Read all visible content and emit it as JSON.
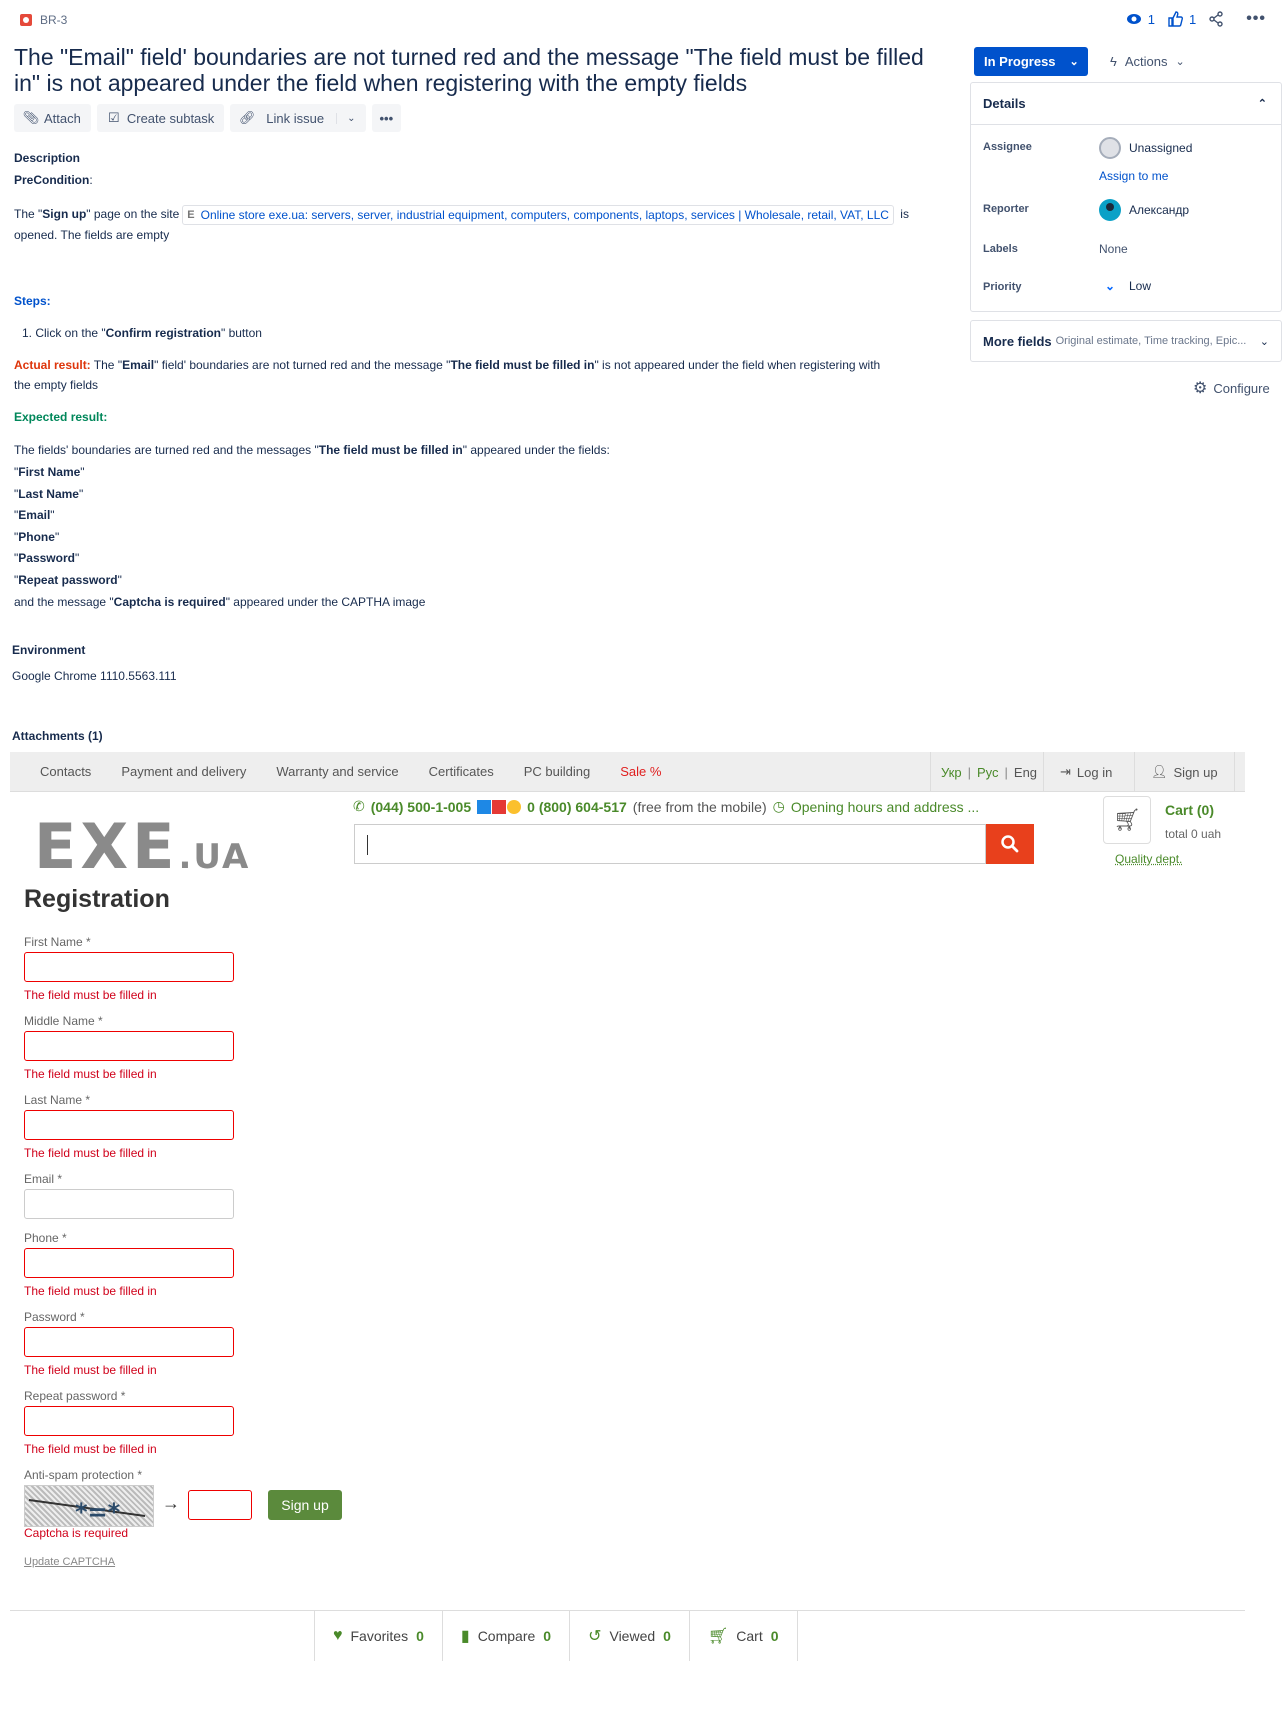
{
  "issue": {
    "key": "BR-3",
    "title": "The \"Email\" field' boundaries are not turned red and the message \"The field must be filled in\" is not appeared under the field when registering with the empty fields",
    "watchers": "1",
    "likes": "1"
  },
  "toolbar": {
    "attach": "Attach",
    "create_subtask": "Create subtask",
    "link_issue": "Link issue"
  },
  "description": {
    "heading": "Description",
    "precondition_label": "PreCondition",
    "precondition_colon": ":",
    "pre_text_1": "The \"",
    "pre_bold": "Sign up",
    "pre_text_2": "\" page on the site",
    "link_text": "Online store exe.ua: servers, server, industrial equipment, computers, components, laptops, services | Wholesale, retail, VAT, LLC",
    "pre_text_3": " is",
    "pre_text_4": "opened. The fields are empty",
    "steps_label": "Steps:",
    "step_1_a": "1. Click on the \"",
    "step_1_bold": "Confirm registration",
    "step_1_b": "\" button",
    "actual_label": "Actual result:",
    "actual_a": " The \"",
    "actual_bold1": "Email",
    "actual_b": "\" field' boundaries are not turned red and the message \"",
    "actual_bold2": "The field must be filled in",
    "actual_c": "\" is not appeared under the field when registering with",
    "actual_d": "the empty fields",
    "expected_label": "Expected result:",
    "expected_a": "The fields' boundaries are turned red and the messages \"",
    "expected_bold": "The field must be filled in",
    "expected_b": "\" appeared under the fields:",
    "fields": [
      "First Name",
      "Last Name",
      "Email",
      "Phone",
      "Password",
      "Repeat password"
    ],
    "captcha_a": "and the message \"",
    "captcha_bold": "Captcha is required",
    "captcha_b": "\" appeared under the CAPTHA image"
  },
  "environment": {
    "heading": "Environment",
    "value": "Google Chrome 1110.5563.111"
  },
  "attachments": {
    "heading": "Attachments (1)"
  },
  "sidebar": {
    "status": "In Progress",
    "actions": "Actions",
    "details_heading": "Details",
    "assignee_label": "Assignee",
    "assignee_value": "Unassigned",
    "assign_to_me": "Assign to me",
    "reporter_label": "Reporter",
    "reporter_value": "Александр",
    "labels_label": "Labels",
    "labels_value": "None",
    "priority_label": "Priority",
    "priority_value": "Low",
    "more_fields": "More fields",
    "more_fields_sub": "Original estimate, Time tracking, Epic...",
    "configure": "Configure"
  },
  "site": {
    "nav": [
      "Contacts",
      "Payment and delivery",
      "Warranty and service",
      "Certificates",
      "PC building"
    ],
    "sale": "Sale %",
    "lang_ukr": "Укр",
    "lang_rus": "Рус",
    "lang_eng": "Eng",
    "sep": "|",
    "login": "Log in",
    "signup": "Sign up",
    "logo_main": "EXE",
    "logo_small": ".UA",
    "phone1": "(044) 500-1-005",
    "phone2": "0 (800) 604-517",
    "phone2_note": "(free from the mobile)",
    "hours": "Opening hours and address ...",
    "cart_title": "Cart (0)",
    "cart_total": "total 0 uah",
    "quality": "Quality dept.",
    "reg_title": "Registration",
    "fields": [
      {
        "label": "First Name *",
        "error": "The field must be filled in"
      },
      {
        "label": "Middle Name *",
        "error": "The field must be filled in"
      },
      {
        "label": "Last Name *",
        "error": "The field must be filled in"
      },
      {
        "label": "Email *",
        "error": ""
      },
      {
        "label": "Phone *",
        "error": "The field must be filled in"
      },
      {
        "label": "Password *",
        "error": "The field must be filled in"
      },
      {
        "label": "Repeat password *",
        "error": "The field must be filled in"
      }
    ],
    "antispam_label": "Anti-spam protection *",
    "captcha_error": "Captcha is required",
    "signup_button": "Sign up",
    "update_captcha": "Update CAPTCHA",
    "bottom": {
      "favorites": "Favorites",
      "favorites_n": "0",
      "compare": "Compare",
      "compare_n": "0",
      "viewed": "Viewed",
      "viewed_n": "0",
      "cart": "Cart",
      "cart_n": "0"
    }
  }
}
